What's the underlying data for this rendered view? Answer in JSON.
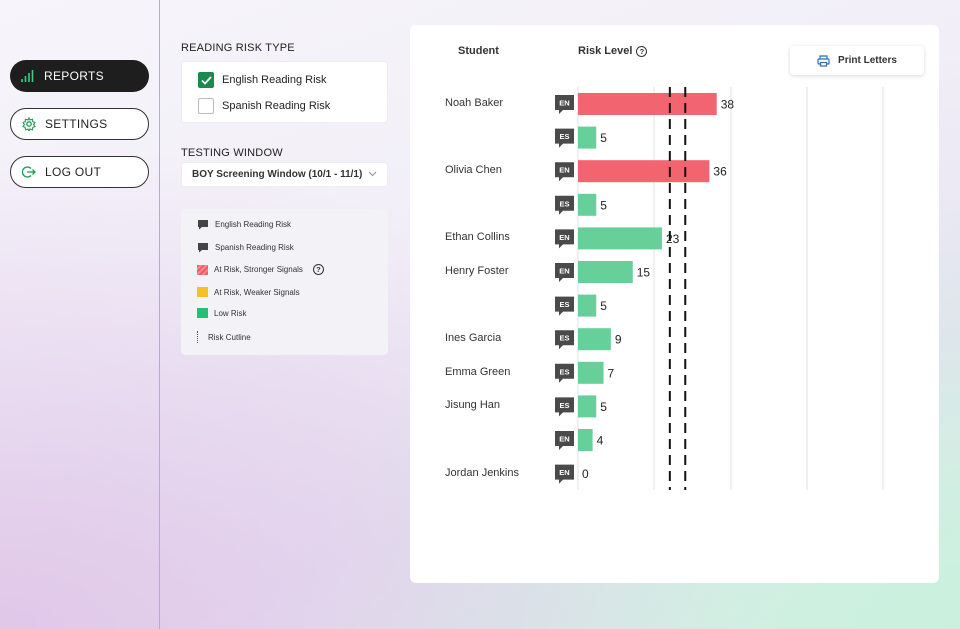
{
  "sidebar": {
    "reports_label": "REPORTS",
    "settings_label": "SETTINGS",
    "logout_label": "LOG OUT"
  },
  "filters": {
    "risk_type_title": "READING RISK TYPE",
    "english_label": "English Reading Risk",
    "english_checked": true,
    "spanish_label": "Spanish Reading Risk",
    "spanish_checked": false,
    "window_title": "TESTING WINDOW",
    "window_value": "BOY Screening Window (10/1 - 11/1)"
  },
  "legend": {
    "english": "English Reading Risk",
    "spanish": "Spanish Reading Risk",
    "at_risk_strong": "At Risk, Stronger Signals",
    "at_risk_weak": "At Risk, Weaker Signals",
    "low_risk": "Low Risk",
    "cutline": "Risk Cutline"
  },
  "table": {
    "student_header": "Student",
    "risk_header": "Risk Level",
    "print_label": "Print Letters"
  },
  "colors": {
    "high": "#f26470",
    "low": "#67cf9a",
    "badge": "#4a4a4a"
  },
  "chart_data": {
    "type": "bar",
    "orientation": "horizontal",
    "ylabel": "Risk Level",
    "cutlines": [
      31,
      36
    ],
    "xlim": [
      0,
      100
    ],
    "rows": [
      {
        "student": "Noah Baker",
        "lang": "EN",
        "value": 38,
        "risk": "high"
      },
      {
        "student": "",
        "lang": "ES",
        "value": 5,
        "risk": "low"
      },
      {
        "student": "Olivia Chen",
        "lang": "EN",
        "value": 36,
        "risk": "high"
      },
      {
        "student": "",
        "lang": "ES",
        "value": 5,
        "risk": "low"
      },
      {
        "student": "Ethan Collins",
        "lang": "EN",
        "value": 23,
        "risk": "low"
      },
      {
        "student": "Henry Foster",
        "lang": "EN",
        "value": 15,
        "risk": "low"
      },
      {
        "student": "",
        "lang": "ES",
        "value": 5,
        "risk": "low"
      },
      {
        "student": "Ines Garcia",
        "lang": "ES",
        "value": 9,
        "risk": "low"
      },
      {
        "student": "Emma Green",
        "lang": "ES",
        "value": 7,
        "risk": "low"
      },
      {
        "student": "Jisung Han",
        "lang": "ES",
        "value": 5,
        "risk": "low"
      },
      {
        "student": "",
        "lang": "EN",
        "value": 4,
        "risk": "low"
      },
      {
        "student": "Jordan Jenkins",
        "lang": "EN",
        "value": 0,
        "risk": "low"
      }
    ]
  }
}
